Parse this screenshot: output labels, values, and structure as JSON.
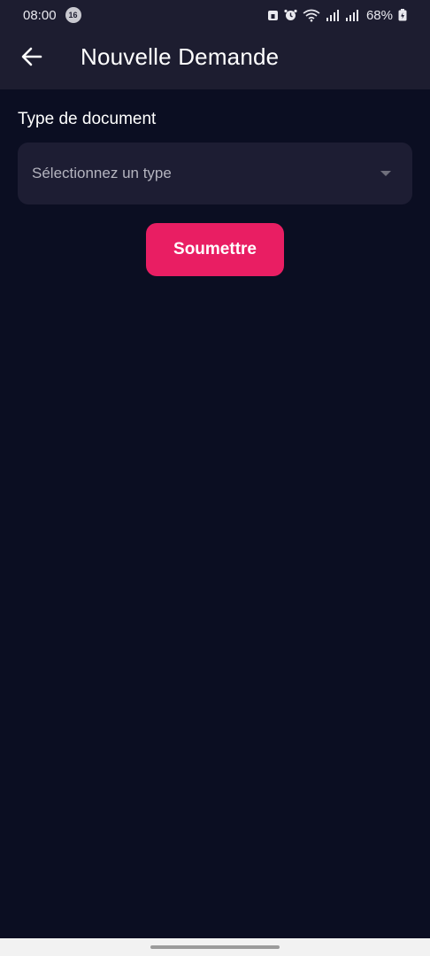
{
  "status_bar": {
    "time": "08:00",
    "notification_count": "16",
    "battery": "68%"
  },
  "app_bar": {
    "title": "Nouvelle Demande",
    "back_icon": "arrow-left-icon"
  },
  "form": {
    "document_type_label": "Type de document",
    "document_type_placeholder": "Sélectionnez un type",
    "submit_label": "Soumettre"
  },
  "colors": {
    "background": "#0b0e22",
    "header": "#1d1d30",
    "field": "#1d1d33",
    "accent": "#e91e63"
  }
}
